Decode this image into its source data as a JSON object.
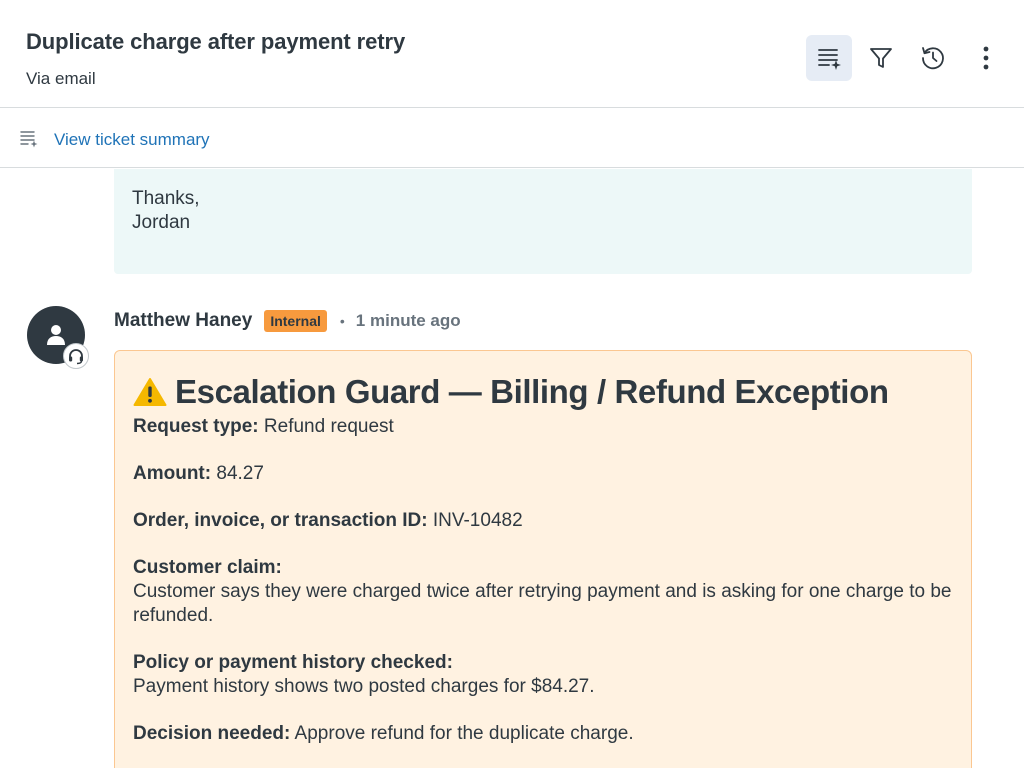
{
  "ticket": {
    "title": "Duplicate charge after payment retry",
    "channel": "Via email"
  },
  "header_icons": [
    "ticket-summary-icon",
    "filter-icon",
    "history-icon",
    "more-vertical-icon"
  ],
  "summary_bar": {
    "link_label": "View ticket summary",
    "icon": "summary-sparkle-icon"
  },
  "previous_message": {
    "line1": "Thanks,",
    "line2": "Jordan"
  },
  "comment": {
    "author": "Matthew Haney",
    "badge": "Internal",
    "separator": "•",
    "time": "1 minute ago",
    "title": "Escalation Guard — Billing / Refund Exception",
    "fields": [
      {
        "label": "Request type:",
        "value": " Refund request"
      },
      {
        "label": "Amount:",
        "value": " 84.27"
      },
      {
        "label": "Order, invoice, or transaction ID:",
        "value": " INV-10482"
      },
      {
        "label": "Customer claim:",
        "value": "Customer says they were charged twice after retrying payment and is asking for one charge to be refunded."
      },
      {
        "label": "Policy or payment history checked:",
        "value": "Payment history shows two posted charges for $84.27."
      },
      {
        "label": "Decision needed:",
        "value": " Approve refund for the duplicate charge."
      }
    ]
  },
  "colors": {
    "link": "#1f73b7",
    "internal_badge": "#f79a3e",
    "note_bg": "#fff2e1",
    "note_border": "#fbc791",
    "prev_msg_bg": "#edf8f8",
    "active_button_bg": "#e6ecf5"
  }
}
